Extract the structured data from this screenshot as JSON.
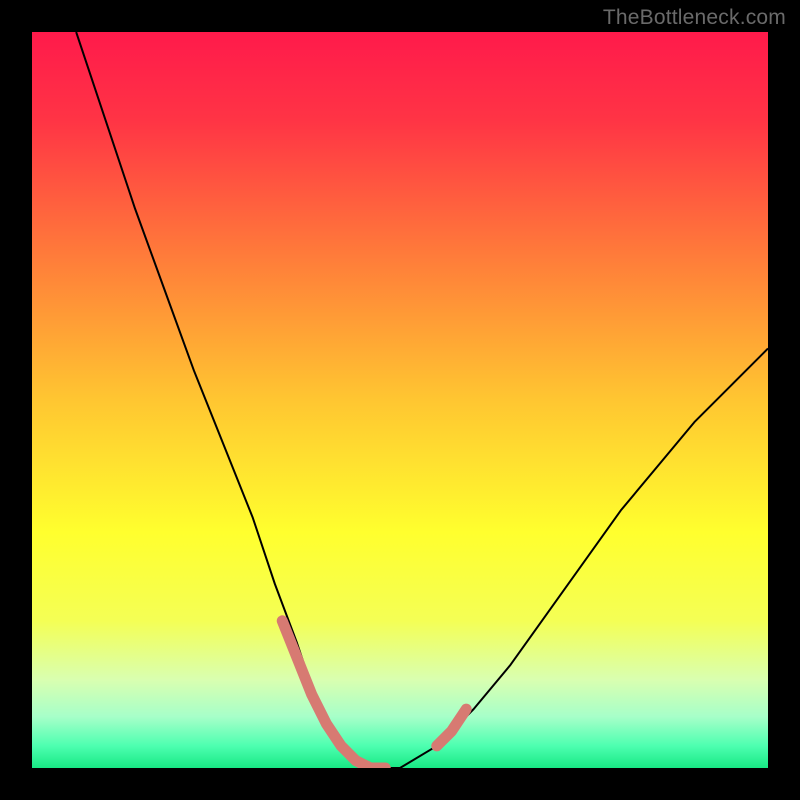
{
  "watermark": "TheBottleneck.com",
  "chart_data": {
    "type": "line",
    "title": "",
    "xlabel": "",
    "ylabel": "",
    "xlim": [
      0,
      100
    ],
    "ylim": [
      0,
      100
    ],
    "legend": false,
    "grid": false,
    "background": "rainbow-vertical-gradient",
    "series": [
      {
        "name": "bottleneck-curve",
        "color": "#000000",
        "stroke_width": 2,
        "x": [
          6,
          10,
          14,
          18,
          22,
          26,
          30,
          33,
          36,
          38,
          40,
          42,
          44,
          46,
          50,
          55,
          60,
          65,
          70,
          75,
          80,
          85,
          90,
          95,
          100
        ],
        "values": [
          100,
          88,
          76,
          65,
          54,
          44,
          34,
          25,
          17,
          11,
          6,
          3,
          1,
          0,
          0,
          3,
          8,
          14,
          21,
          28,
          35,
          41,
          47,
          52,
          57
        ]
      },
      {
        "name": "highlight-segment-left",
        "color": "#d77a72",
        "stroke_width": 11,
        "linecap": "round",
        "x": [
          34,
          36,
          38,
          40,
          42,
          44,
          46,
          48
        ],
        "values": [
          20,
          15,
          10,
          6,
          3,
          1,
          0,
          0
        ]
      },
      {
        "name": "highlight-segment-right",
        "color": "#d77a72",
        "stroke_width": 11,
        "linecap": "round",
        "x": [
          55,
          57,
          59
        ],
        "values": [
          3,
          5,
          8
        ]
      }
    ],
    "gradient_stops": [
      {
        "offset": 0.0,
        "color": "#ff1a4b"
      },
      {
        "offset": 0.12,
        "color": "#ff3445"
      },
      {
        "offset": 0.3,
        "color": "#ff7a3a"
      },
      {
        "offset": 0.5,
        "color": "#ffc631"
      },
      {
        "offset": 0.68,
        "color": "#ffff2e"
      },
      {
        "offset": 0.8,
        "color": "#f4ff55"
      },
      {
        "offset": 0.88,
        "color": "#d9ffb0"
      },
      {
        "offset": 0.93,
        "color": "#a7ffc9"
      },
      {
        "offset": 0.97,
        "color": "#4dffb0"
      },
      {
        "offset": 1.0,
        "color": "#18e884"
      }
    ]
  }
}
